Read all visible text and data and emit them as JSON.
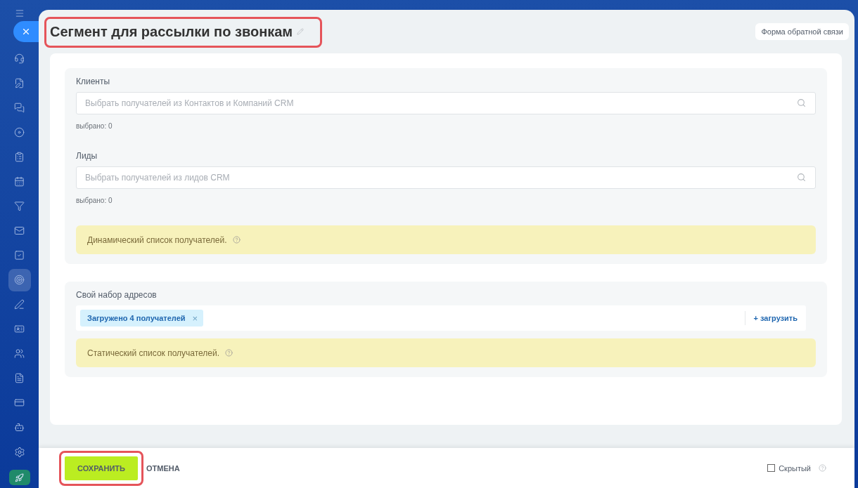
{
  "sidebar": {
    "items": [
      {
        "selected": false
      },
      {
        "selected": false
      },
      {
        "selected": false
      },
      {
        "selected": false
      },
      {
        "selected": false
      },
      {
        "selected": false
      },
      {
        "selected": false
      },
      {
        "selected": false
      },
      {
        "selected": false
      },
      {
        "selected": true
      },
      {
        "selected": false
      },
      {
        "selected": false
      },
      {
        "selected": false
      },
      {
        "selected": false
      },
      {
        "selected": false
      },
      {
        "selected": false
      }
    ]
  },
  "title": "Сегмент для рассылки по звонкам",
  "feedback_button": "Форма обратной связи",
  "sections": [
    {
      "kind": "selectors",
      "fields": [
        {
          "label": "Клиенты",
          "placeholder": "Выбрать получателей из Контактов и Компаний CRM",
          "count": "выбрано:  0"
        },
        {
          "label": "Лиды",
          "placeholder": "Выбрать получателей из лидов CRM",
          "count": "выбрано:  0"
        }
      ],
      "notice": "Динамический список получателей."
    },
    {
      "kind": "custom",
      "label": "Свой набор адресов",
      "tag": "Загружено 4 получателей",
      "tag_remove": "×",
      "upload": "+ загрузить",
      "notice": "Статический список получателей."
    }
  ],
  "footer": {
    "save": "СОХРАНИТЬ",
    "cancel": "ОТМЕНА",
    "hidden": {
      "label": "Скрытый",
      "checked": false
    }
  }
}
